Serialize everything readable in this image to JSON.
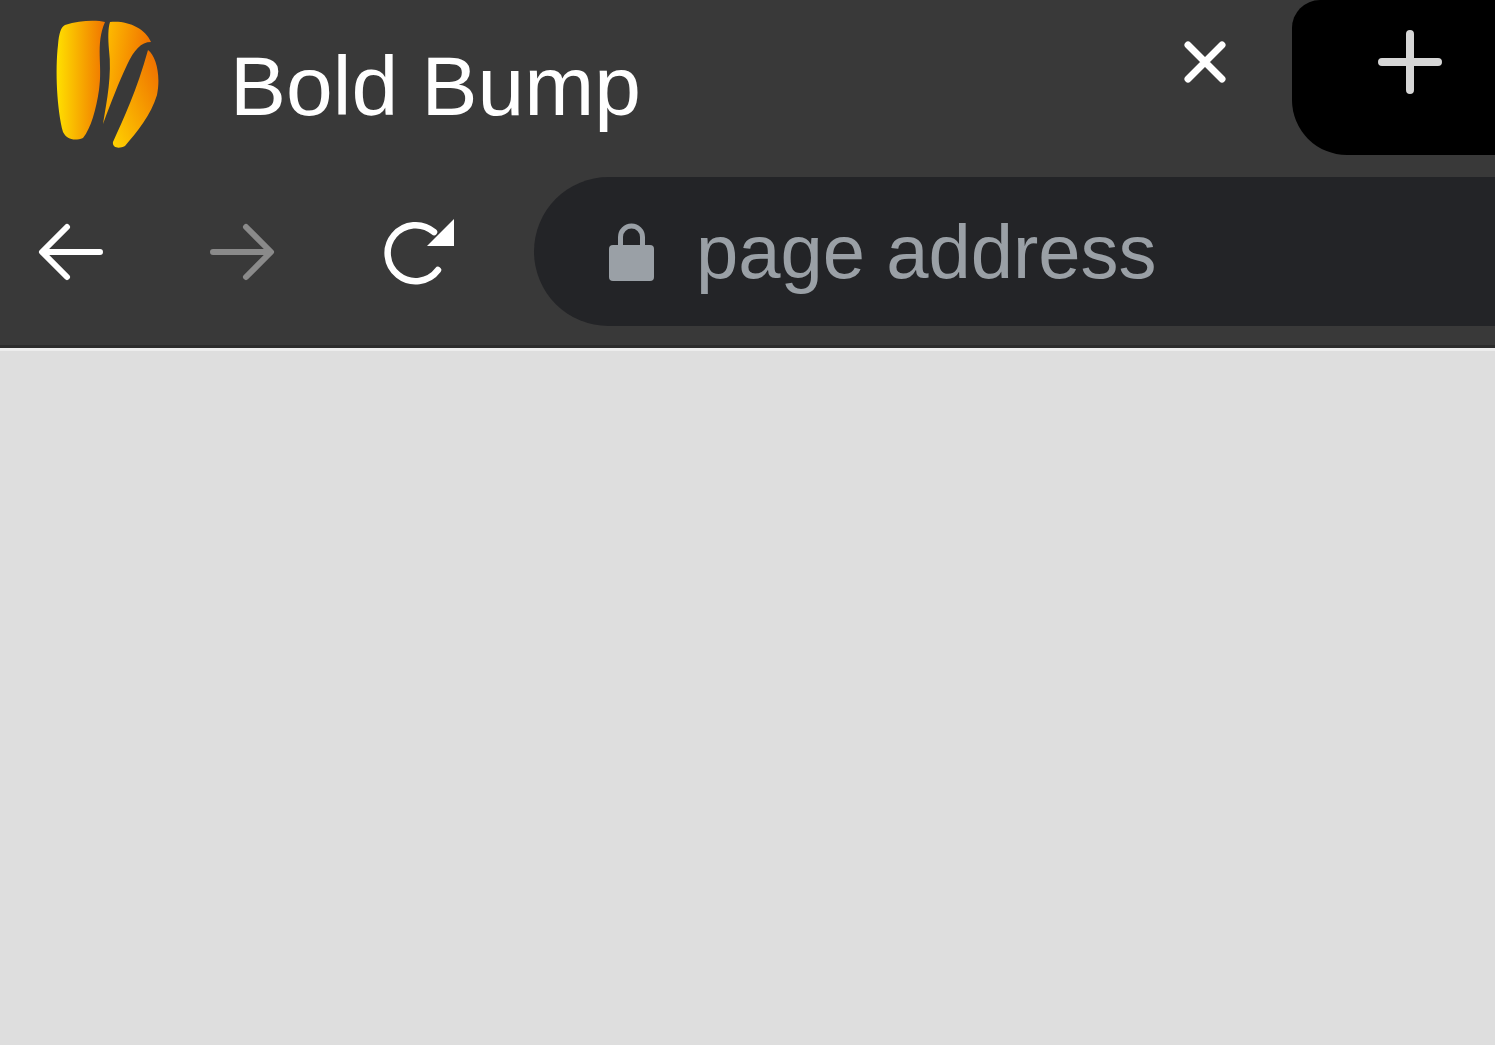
{
  "tabs": [
    {
      "title": "Bold Bump",
      "selected": true
    }
  ],
  "nav_buttons": [
    {
      "kind": "back",
      "disabled": false
    },
    {
      "kind": "forward",
      "disabled": true
    },
    {
      "kind": "reload",
      "disabled": false
    }
  ],
  "address_bar": {
    "placeholder": "page address",
    "secure": true
  }
}
